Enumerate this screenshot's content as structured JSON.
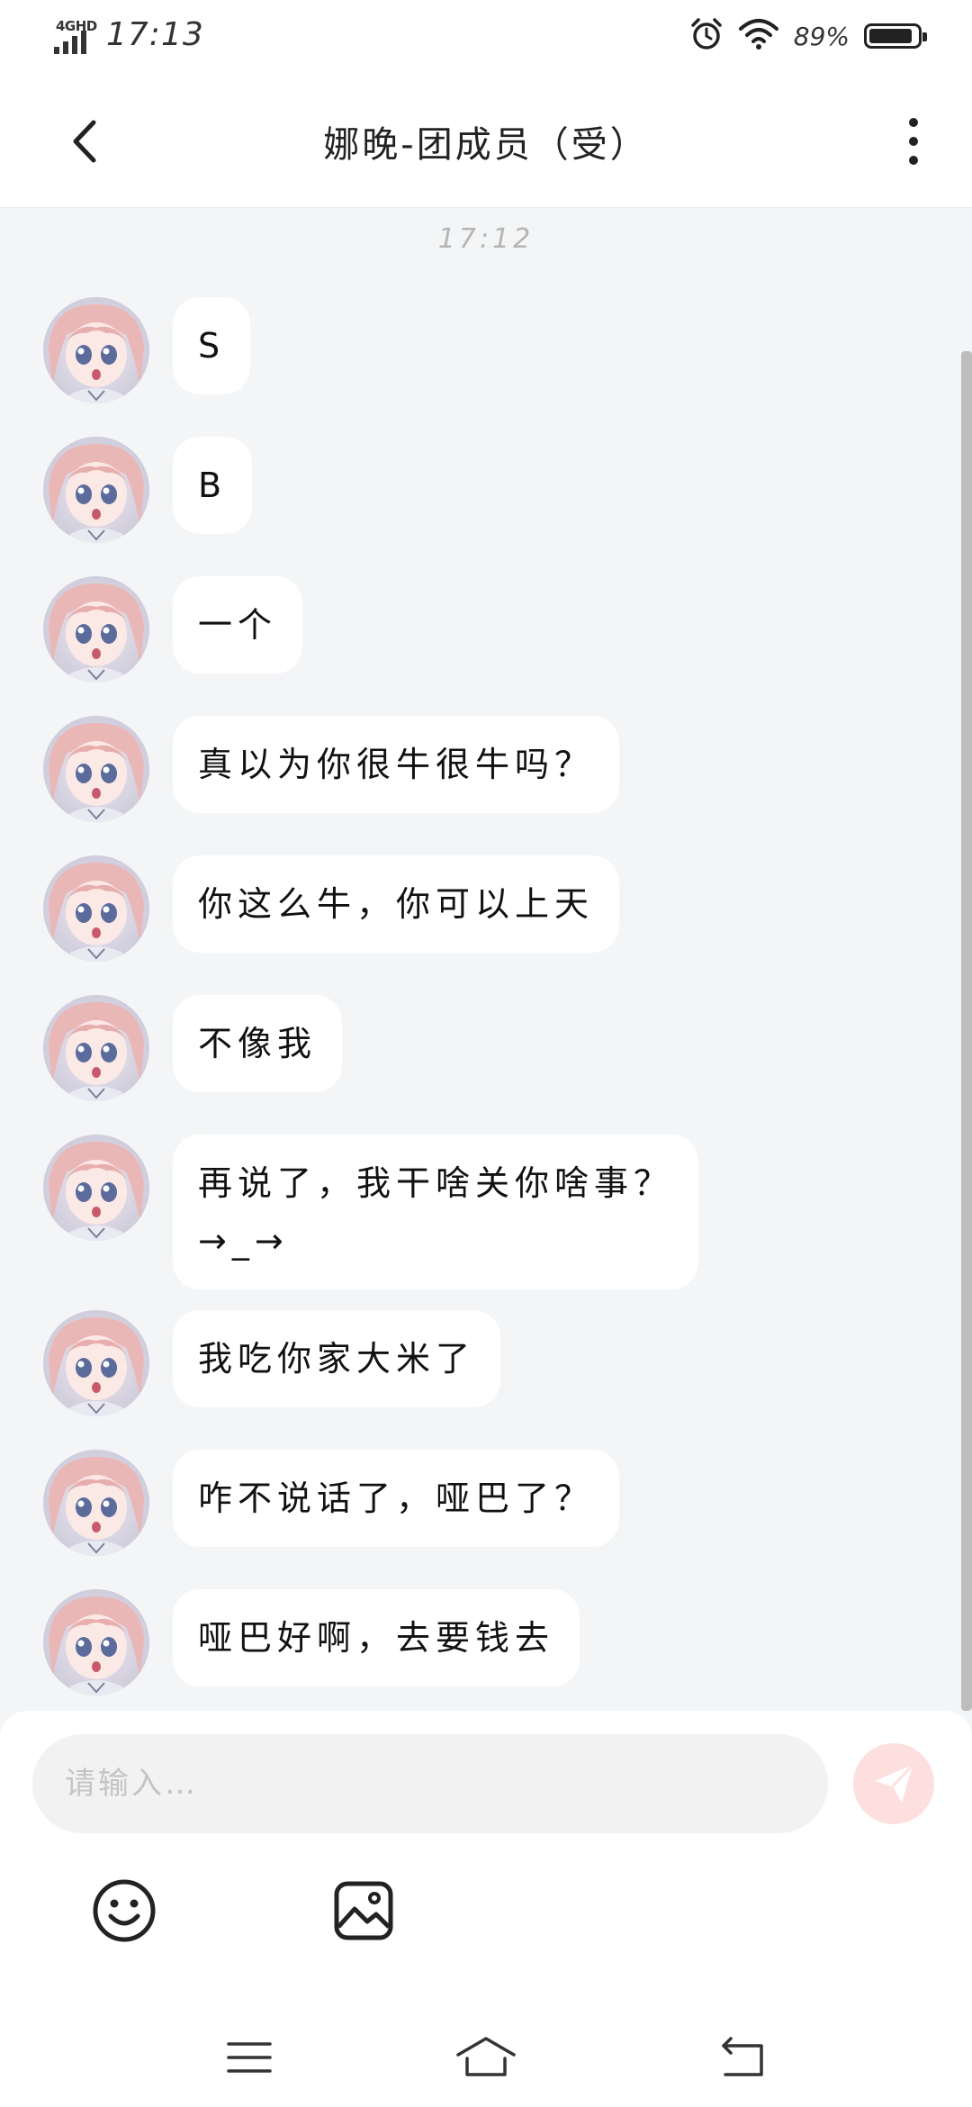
{
  "status_bar": {
    "network": "4GHD",
    "time": "17:13",
    "battery_percent": "89%",
    "icons": [
      "signal-icon",
      "alarm-icon",
      "wifi-icon",
      "battery-icon"
    ]
  },
  "header": {
    "title": "娜晚-团成员（受）",
    "back_icon": "chevron-left-icon",
    "more_icon": "more-vertical-icon"
  },
  "chat": {
    "timestamp": "17:12",
    "messages": [
      {
        "text": "S"
      },
      {
        "text": "B"
      },
      {
        "text": "一个"
      },
      {
        "text": "真以为你很牛很牛吗？"
      },
      {
        "text": "你这么牛，你可以上天"
      },
      {
        "text": "不像我"
      },
      {
        "text": "再说了，我干啥关你啥事？\n→_→"
      },
      {
        "text": "我吃你家大米了"
      },
      {
        "text": "咋不说话了，哑巴了？"
      },
      {
        "text": "哑巴好啊，去要钱去"
      }
    ]
  },
  "composer": {
    "placeholder": "请输入…",
    "value": "",
    "send_icon": "send-icon",
    "send_color": "#fde0de",
    "tools": [
      "emoji-icon",
      "image-icon"
    ]
  },
  "nav_bar": {
    "icons": [
      "menu-icon",
      "home-icon",
      "back-icon"
    ]
  },
  "colors": {
    "background": "#f4f5f7",
    "bubble": "#ffffff",
    "text": "#111111"
  }
}
